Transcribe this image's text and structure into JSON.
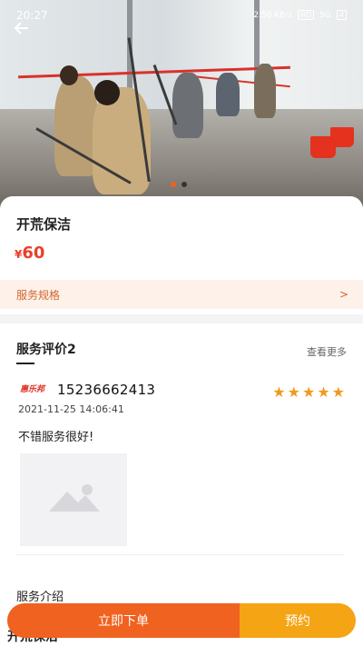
{
  "status_bar": {
    "time": "20:27",
    "network_speed": "2.50 KB/s",
    "hd_badge": "HD",
    "signal": "5G",
    "battery": "4"
  },
  "icons": {
    "back": "back-arrow-icon",
    "chevron": "chevron-right-icon",
    "star": "star-icon",
    "image_placeholder": "image-placeholder-icon"
  },
  "colors": {
    "accent_orange": "#f0621f",
    "accent_yellow": "#f5a414",
    "price_red": "#e8402a",
    "star_orange": "#f19a1c"
  },
  "carousel": {
    "total": 2,
    "active": 0
  },
  "product": {
    "title": "开荒保洁",
    "currency": "¥",
    "price": "60",
    "spec_label": "服务规格",
    "spec_chevron": ">"
  },
  "reviews": {
    "title": "服务评价2",
    "more_label": "查看更多",
    "items": [
      {
        "logo_text": "惠乐邦",
        "user": "15236662413",
        "rating": 5,
        "date": "2021-11-25 14:06:41",
        "comment": "不错服务很好!"
      }
    ]
  },
  "intro": {
    "heading": "服务介绍",
    "content_title": "开荒保洁"
  },
  "actions": {
    "buy_label": "立即下单",
    "reserve_label": "预约"
  }
}
